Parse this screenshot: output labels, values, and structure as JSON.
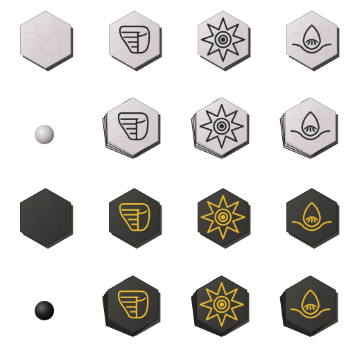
{
  "sheet": {
    "rows": [
      {
        "theme": "white",
        "variant": "single",
        "tiles": [
          "blank",
          "wing",
          "sun",
          "eye"
        ]
      },
      {
        "theme": "white",
        "variant": "stack",
        "piece": "marble-orb",
        "tiles": [
          "wing",
          "sun",
          "eye"
        ]
      },
      {
        "theme": "black",
        "variant": "single",
        "tiles": [
          "blank",
          "wing",
          "sun",
          "eye"
        ]
      },
      {
        "theme": "black",
        "variant": "stack",
        "piece": "obsidian-orb",
        "tiles": [
          "wing",
          "sun",
          "eye"
        ]
      }
    ]
  },
  "colors": {
    "white_marble": "#d9d2d3",
    "white_marble_vein": "#b8adaf",
    "white_glyph": "#2a2a2a",
    "black_marble": "#3d3b38",
    "black_marble_vein": "#2c2a28",
    "black_glyph": "#e6b830",
    "shadow": "#1e1e1e"
  }
}
